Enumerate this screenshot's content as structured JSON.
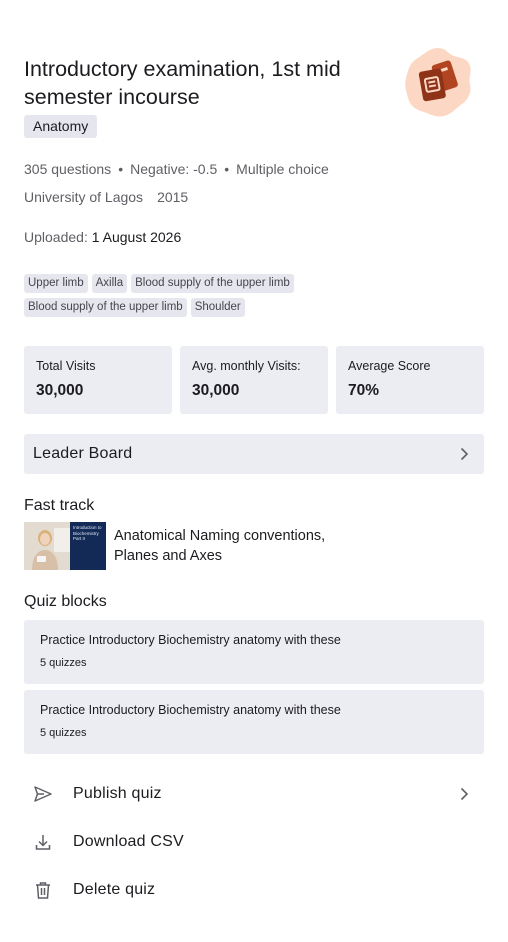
{
  "quiz": {
    "title": "Introductory examination, 1st mid semester incourse",
    "subject": "Anatomy",
    "question_count": "305 questions",
    "negative": "Negative: -0.5",
    "type": "Multiple choice",
    "institution": "University of Lagos",
    "year": "2015",
    "uploaded_label": "Uploaded:",
    "uploaded_date": "1 August 2026",
    "tags": [
      "Upper limb",
      "Axilla",
      "Blood supply of the upper limb",
      "Blood supply of the upper limb",
      "Shoulder"
    ]
  },
  "stats": [
    {
      "label": "Total Visits",
      "value": "30,000"
    },
    {
      "label": "Avg. monthly Visits:",
      "value": "30,000"
    },
    {
      "label": "Average Score",
      "value": "70%"
    }
  ],
  "leaderboard": {
    "label": "Leader Board"
  },
  "fast_track": {
    "heading": "Fast track",
    "thumb_text": "Introduction to Biochemistry Part II",
    "title": "Anatomical Naming conventions, Planes and Axes"
  },
  "quiz_blocks": {
    "heading": "Quiz blocks",
    "items": [
      {
        "title": "Practice Introductory Biochemistry anatomy with these",
        "count": "5 quizzes"
      },
      {
        "title": "Practice Introductory Biochemistry anatomy with these",
        "count": "5 quizzes"
      }
    ]
  },
  "actions": {
    "publish": "Publish quiz",
    "download": "Download CSV",
    "delete": "Delete quiz"
  },
  "icons": {
    "logo": "quiz-cards-icon",
    "chevron": "chevron-right-icon",
    "publish": "send-icon",
    "download": "download-icon",
    "delete": "trash-icon"
  },
  "colors": {
    "logo_bg": "#fcd8c4",
    "logo_fg": "#8f3318",
    "card_bg": "#ececf3",
    "chip_bg": "#e6e6ef"
  }
}
